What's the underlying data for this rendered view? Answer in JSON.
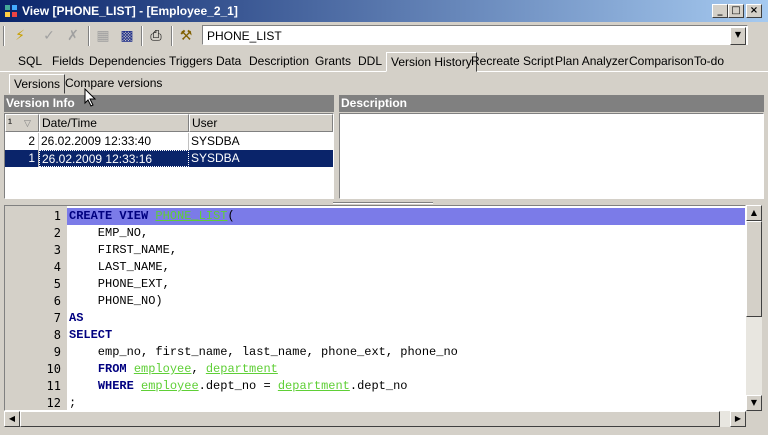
{
  "window": {
    "title": "View [PHONE_LIST] - [Employee_2_1]"
  },
  "toolbar": {
    "object_name": "PHONE_LIST"
  },
  "tabs": [
    "SQL",
    "Fields",
    "Dependencies",
    "Triggers",
    "Data",
    "Description",
    "Grants",
    "DDL",
    "Version History",
    "Recreate Script",
    "Plan Analyzer",
    "Comparison",
    "To-do"
  ],
  "subtabs": [
    "Versions",
    "Compare versions"
  ],
  "version_info": {
    "title": "Version Info",
    "columns": [
      "¹",
      "Date/Time",
      "User"
    ],
    "rows": [
      {
        "num": "2",
        "datetime": "26.02.2009 12:33:40",
        "user": "SYSDBA"
      },
      {
        "num": "1",
        "datetime": "26.02.2009 12:33:16",
        "user": "SYSDBA"
      }
    ]
  },
  "description": {
    "title": "Description"
  },
  "editor": {
    "line_numbers": [
      "1",
      "2",
      "3",
      "4",
      "5",
      "6",
      "7",
      "8",
      "9",
      "10",
      "11",
      "12"
    ],
    "lines": [
      [
        {
          "t": "CREATE VIEW ",
          "c": "kw"
        },
        {
          "t": "PHONE_LIST",
          "c": "id"
        },
        {
          "t": "(",
          "c": ""
        }
      ],
      [
        {
          "t": "    EMP_NO,",
          "c": ""
        }
      ],
      [
        {
          "t": "    FIRST_NAME,",
          "c": ""
        }
      ],
      [
        {
          "t": "    LAST_NAME,",
          "c": ""
        }
      ],
      [
        {
          "t": "    PHONE_EXT,",
          "c": ""
        }
      ],
      [
        {
          "t": "    PHONE_NO)",
          "c": ""
        }
      ],
      [
        {
          "t": "AS",
          "c": "kw"
        }
      ],
      [
        {
          "t": "SELECT",
          "c": "kw"
        }
      ],
      [
        {
          "t": "    emp_no, first_name, last_name, phone_ext, phone_no",
          "c": ""
        }
      ],
      [
        {
          "t": "    ",
          "c": ""
        },
        {
          "t": "FROM ",
          "c": "kw"
        },
        {
          "t": "employee",
          "c": "id"
        },
        {
          "t": ", ",
          "c": ""
        },
        {
          "t": "department",
          "c": "id"
        }
      ],
      [
        {
          "t": "    ",
          "c": ""
        },
        {
          "t": "WHERE ",
          "c": "kw"
        },
        {
          "t": "employee",
          "c": "id"
        },
        {
          "t": ".dept_no = ",
          "c": ""
        },
        {
          "t": "department",
          "c": "id"
        },
        {
          "t": ".dept_no",
          "c": ""
        }
      ],
      [
        {
          "t": ";",
          "c": ""
        }
      ]
    ]
  },
  "colors": {
    "title_start": "#0a246a",
    "selection": "#0a246a",
    "current_line": "#7b7be8",
    "identifier": "#5fcf36"
  }
}
